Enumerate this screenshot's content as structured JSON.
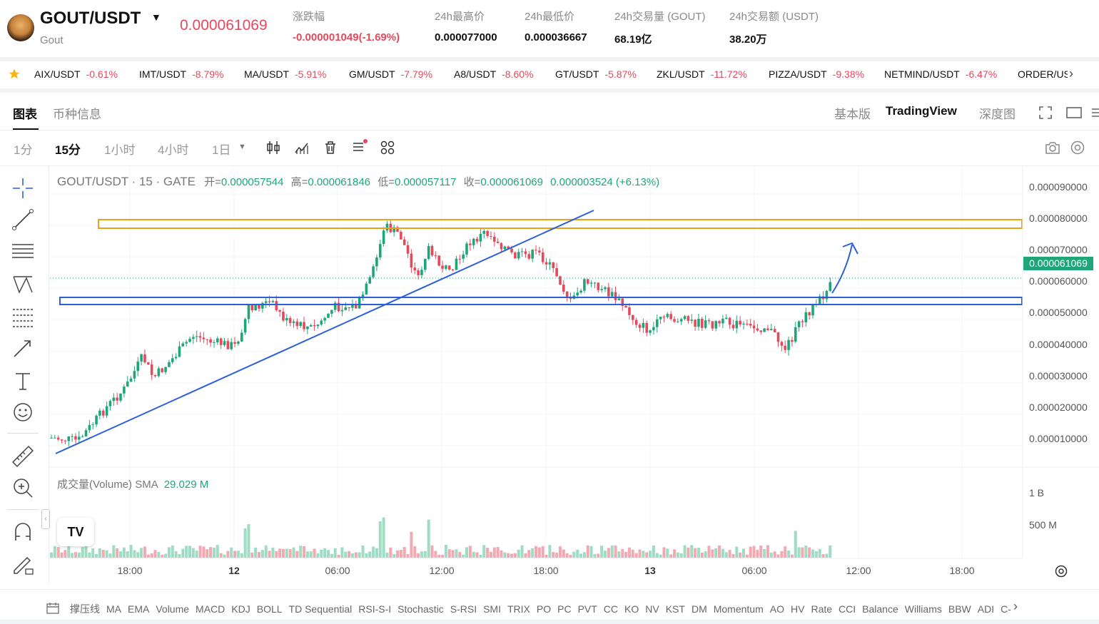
{
  "header": {
    "pair": "GOUT/USDT",
    "coin_name": "Gout",
    "last_price": "0.000061069",
    "stats": [
      {
        "label": "涨跌幅",
        "value": "-0.000001049(-1.69%)",
        "tone": "neg"
      },
      {
        "label": "24h最高价",
        "value": "0.000077000",
        "tone": ""
      },
      {
        "label": "24h最低价",
        "value": "0.000036667",
        "tone": ""
      },
      {
        "label": "24h交易量 (GOUT)",
        "value": "68.19亿",
        "tone": ""
      },
      {
        "label": "24h交易额 (USDT)",
        "value": "38.20万",
        "tone": ""
      }
    ]
  },
  "ticker": [
    {
      "name": "AIX/USDT",
      "change": "-0.61%"
    },
    {
      "name": "IMT/USDT",
      "change": "-8.79%"
    },
    {
      "name": "MA/USDT",
      "change": "-5.91%"
    },
    {
      "name": "GM/USDT",
      "change": "-7.79%"
    },
    {
      "name": "A8/USDT",
      "change": "-8.60%"
    },
    {
      "name": "GT/USDT",
      "change": "-5.87%"
    },
    {
      "name": "ZKL/USDT",
      "change": "-11.72%"
    },
    {
      "name": "PIZZA/USDT",
      "change": "-9.38%"
    },
    {
      "name": "NETMIND/USDT",
      "change": "-6.47%"
    },
    {
      "name": "ORDER/USDT",
      "change": ""
    }
  ],
  "tabs": {
    "left": [
      "图表",
      "币种信息"
    ],
    "right": [
      "基本版",
      "TradingView",
      "深度图"
    ]
  },
  "timeframes": [
    "1分",
    "15分",
    "1小时",
    "4小时",
    "1日"
  ],
  "legend": {
    "title": "GOUT/USDT · 15 · GATE",
    "open_label": "开=",
    "open": "0.000057544",
    "high_label": "高=",
    "high": "0.000061846",
    "low_label": "低=",
    "low": "0.000057117",
    "close_label": "收=",
    "close": "0.000061069",
    "change": "0.000003524 (+6.13%)"
  },
  "volume_legend": {
    "label": "成交量(Volume) SMA",
    "value": "29.029 M"
  },
  "price_axis": [
    "0.000090000",
    "0.000080000",
    "0.000070000",
    "0.000060000",
    "0.000050000",
    "0.000040000",
    "0.000030000",
    "0.000020000",
    "0.000010000"
  ],
  "price_tag": "0.000061069",
  "volume_axis": [
    "1 B",
    "500 M"
  ],
  "time_axis": [
    {
      "label": "18:00",
      "bold": false
    },
    {
      "label": "12",
      "bold": true
    },
    {
      "label": "06:00",
      "bold": false
    },
    {
      "label": "12:00",
      "bold": false
    },
    {
      "label": "18:00",
      "bold": false
    },
    {
      "label": "13",
      "bold": true
    },
    {
      "label": "06:00",
      "bold": false
    },
    {
      "label": "12:00",
      "bold": false
    },
    {
      "label": "18:00",
      "bold": false
    }
  ],
  "indicators": [
    "撑压线",
    "MA",
    "EMA",
    "Volume",
    "MACD",
    "KDJ",
    "BOLL",
    "TD Sequential",
    "RSI-S-I",
    "Stochastic",
    "S-RSI",
    "SMI",
    "TRIX",
    "PO",
    "PC",
    "PVT",
    "CC",
    "KO",
    "NV",
    "KST",
    "DM",
    "Momentum",
    "AO",
    "HV",
    "Rate",
    "CCI",
    "Balance",
    "Williams",
    "BBW",
    "ADI",
    "C-F"
  ],
  "watermark": "TV",
  "colors": {
    "up": "#1ea67a",
    "down": "#e5495c",
    "trend": "#2d5fd8",
    "resistance": "#e8a317",
    "support": "#2d5fd8"
  }
}
